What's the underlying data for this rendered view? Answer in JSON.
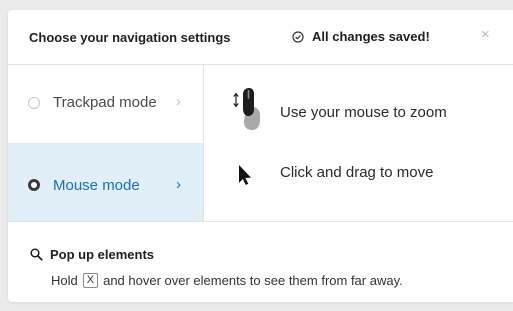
{
  "header": {
    "title": "Choose your navigation settings",
    "status": "All changes saved!",
    "status_icon": "check-circle-icon",
    "close_label": "×"
  },
  "modes": [
    {
      "label": "Trackpad mode",
      "selected": false,
      "chevron": "›"
    },
    {
      "label": "Mouse mode",
      "selected": true,
      "chevron": "›"
    }
  ],
  "instructions": [
    {
      "icon": "mouse-scroll-icon",
      "text": "Use your mouse to zoom"
    },
    {
      "icon": "cursor-arrow-icon",
      "text": "Click and drag to move"
    }
  ],
  "popup": {
    "icon": "magnifier-icon",
    "title": "Pop up elements",
    "desc_before": "Hold",
    "key": "X",
    "desc_after": "and hover over elements to see them from far away."
  },
  "colors": {
    "accent": "#1b6fb3",
    "active_bg": "#e1eff9"
  }
}
